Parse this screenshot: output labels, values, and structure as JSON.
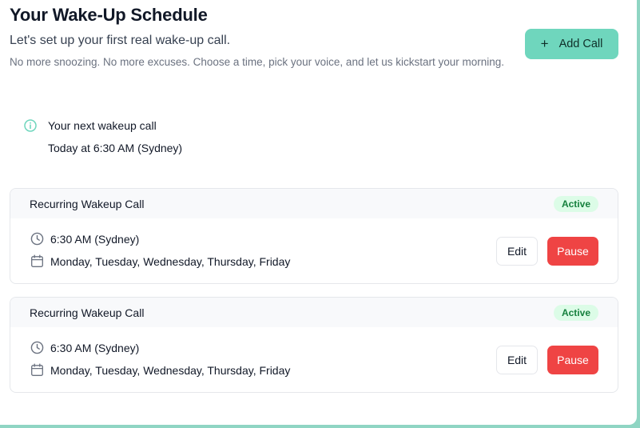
{
  "header": {
    "title": "Your Wake-Up Schedule",
    "subtitle": "Let's set up your first real wake-up call.",
    "description": "No more snoozing. No more excuses. Choose a time, pick your voice, and let us kickstart your morning."
  },
  "add_button": {
    "label": "Add Call",
    "icon": "plus-icon"
  },
  "next_call": {
    "title": "Your next wakeup call",
    "time": "Today at 6:30 AM (Sydney)",
    "icon": "info-icon"
  },
  "calls": [
    {
      "title": "Recurring Wakeup Call",
      "status": "Active",
      "time": "6:30 AM (Sydney)",
      "days": "Monday, Tuesday, Wednesday, Thursday, Friday",
      "edit_label": "Edit",
      "pause_label": "Pause"
    },
    {
      "title": "Recurring Wakeup Call",
      "status": "Active",
      "time": "6:30 AM (Sydney)",
      "days": "Monday, Tuesday, Wednesday, Thursday, Friday",
      "edit_label": "Edit",
      "pause_label": "Pause"
    }
  ],
  "colors": {
    "accent": "#6fd6bd",
    "danger": "#ef4444",
    "active_badge_bg": "#dcfce7",
    "active_badge_text": "#15803d"
  }
}
